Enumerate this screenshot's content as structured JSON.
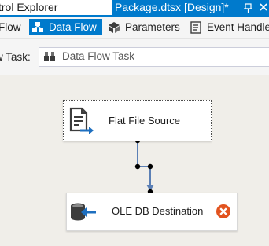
{
  "tabs": {
    "left_tab_label": "trol Explorer",
    "active_tab_label": "Package.dtsx [Design]*"
  },
  "designer_tabs": [
    {
      "label": "Flow",
      "active": false
    },
    {
      "label": "Data Flow",
      "active": true
    },
    {
      "label": "Parameters",
      "active": false
    },
    {
      "label": "Event Handle",
      "active": false
    }
  ],
  "task_selector": {
    "label": "w Task:",
    "value": "Data Flow Task"
  },
  "components": {
    "source": {
      "label": "Flat File Source"
    },
    "destination": {
      "label": "OLE DB Destination",
      "status": "error"
    }
  },
  "colors": {
    "accent": "#007acc",
    "error": "#e2531f",
    "connector": "#5b7fb5"
  }
}
